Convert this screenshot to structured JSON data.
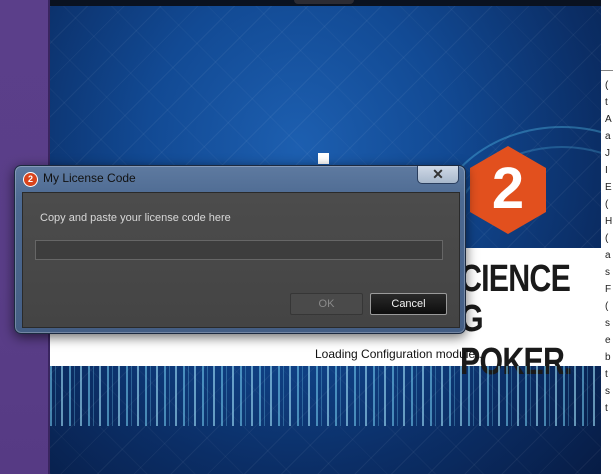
{
  "splash": {
    "logo_number": "2",
    "tagline_line1": "CIENCE",
    "tagline_line2": "G POKER.",
    "loading_text": "Loading Configuration module..."
  },
  "right_edge_chars": [
    "(",
    "t",
    "A",
    "a",
    "J",
    "I",
    "E",
    "(",
    "H",
    "(",
    "a",
    "s",
    "F",
    "(",
    "s",
    "e",
    "b",
    "t",
    "s",
    "t"
  ],
  "dialog": {
    "title": "My License Code",
    "app_icon_label": "2",
    "close_glyph": "✕",
    "prompt": "Copy and paste your license code here",
    "license_value": "",
    "ok_label": "OK",
    "cancel_label": "Cancel"
  },
  "colors": {
    "logo_orange": "#e2501e",
    "splash_blue": "#124a94",
    "dialog_client": "#4c4c4c"
  }
}
